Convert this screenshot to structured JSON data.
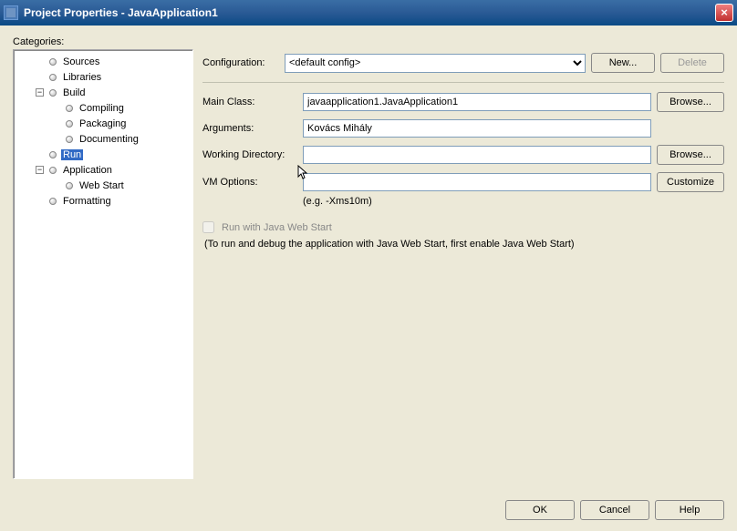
{
  "window": {
    "title": "Project Properties - JavaApplication1",
    "close_icon_label": "×"
  },
  "categories_label": "Categories:",
  "tree": {
    "sources": "Sources",
    "libraries": "Libraries",
    "build": "Build",
    "compiling": "Compiling",
    "packaging": "Packaging",
    "documenting": "Documenting",
    "run": "Run",
    "application": "Application",
    "webstart": "Web Start",
    "formatting": "Formatting"
  },
  "config": {
    "label": "Configuration:",
    "selected": "<default config>",
    "new_label": "New...",
    "delete_label": "Delete"
  },
  "fields": {
    "main_class_label": "Main Class:",
    "main_class_value": "javaapplication1.JavaApplication1",
    "browse1_label": "Browse...",
    "arguments_label": "Arguments:",
    "arguments_value": "Kovács Mihály",
    "workdir_label": "Working Directory:",
    "workdir_value": "",
    "browse2_label": "Browse...",
    "vmoptions_label": "VM Options:",
    "vmoptions_value": "",
    "customize_label": "Customize",
    "vmoptions_hint": "(e.g. -Xms10m)"
  },
  "webstart": {
    "checkbox_label": "Run with Java Web Start",
    "note": "(To run and debug the application with Java Web Start, first enable Java Web Start)"
  },
  "footer": {
    "ok": "OK",
    "cancel": "Cancel",
    "help": "Help"
  }
}
